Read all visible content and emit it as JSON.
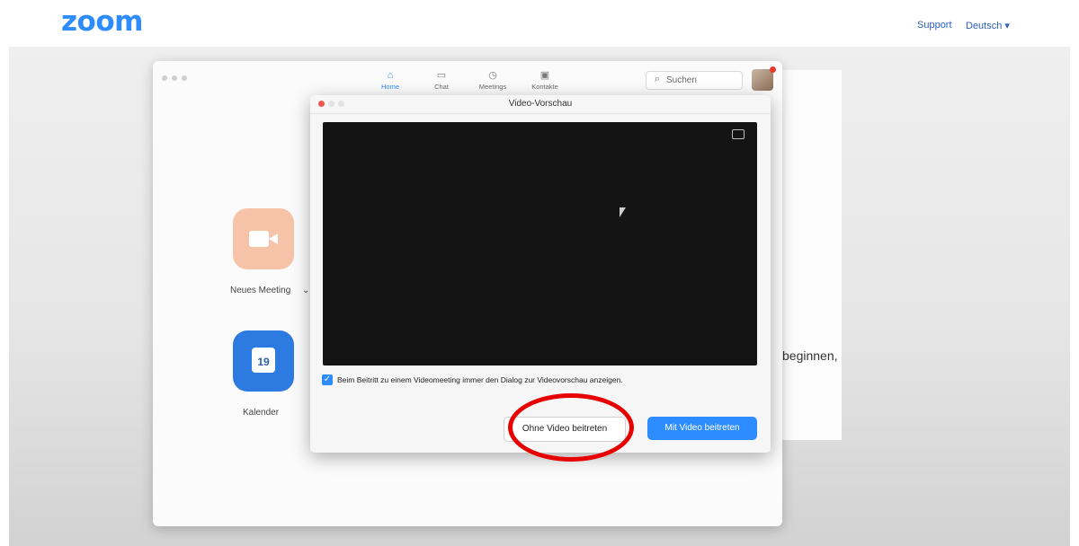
{
  "site": {
    "logo": "zoom",
    "support": "Support",
    "language": "Deutsch ▾"
  },
  "app": {
    "nav": [
      {
        "label": "Home",
        "icon": "home-icon"
      },
      {
        "label": "Chat",
        "icon": "chat-icon"
      },
      {
        "label": "Meetings",
        "icon": "clock-icon"
      },
      {
        "label": "Kontakte",
        "icon": "contacts-icon"
      }
    ],
    "search_placeholder": "Suchen",
    "tiles": {
      "new_meeting": "Neues Meeting",
      "new_meeting_chevron": "⌄",
      "calendar": "Kalender",
      "calendar_day": "19"
    },
    "peek_text": "beginnen,",
    "peek_dot": "."
  },
  "dialog": {
    "title": "Video-Vorschau",
    "checkbox_label": "Beim Beitritt zu einem Videomeeting immer den Dialog zur Videovorschau anzeigen.",
    "checkbox_checked": true,
    "button_without_video": "Ohne Video beitreten",
    "button_with_video": "Mit Video beitreten"
  },
  "colors": {
    "brand": "#2d8cff",
    "highlight": "#e80000"
  }
}
